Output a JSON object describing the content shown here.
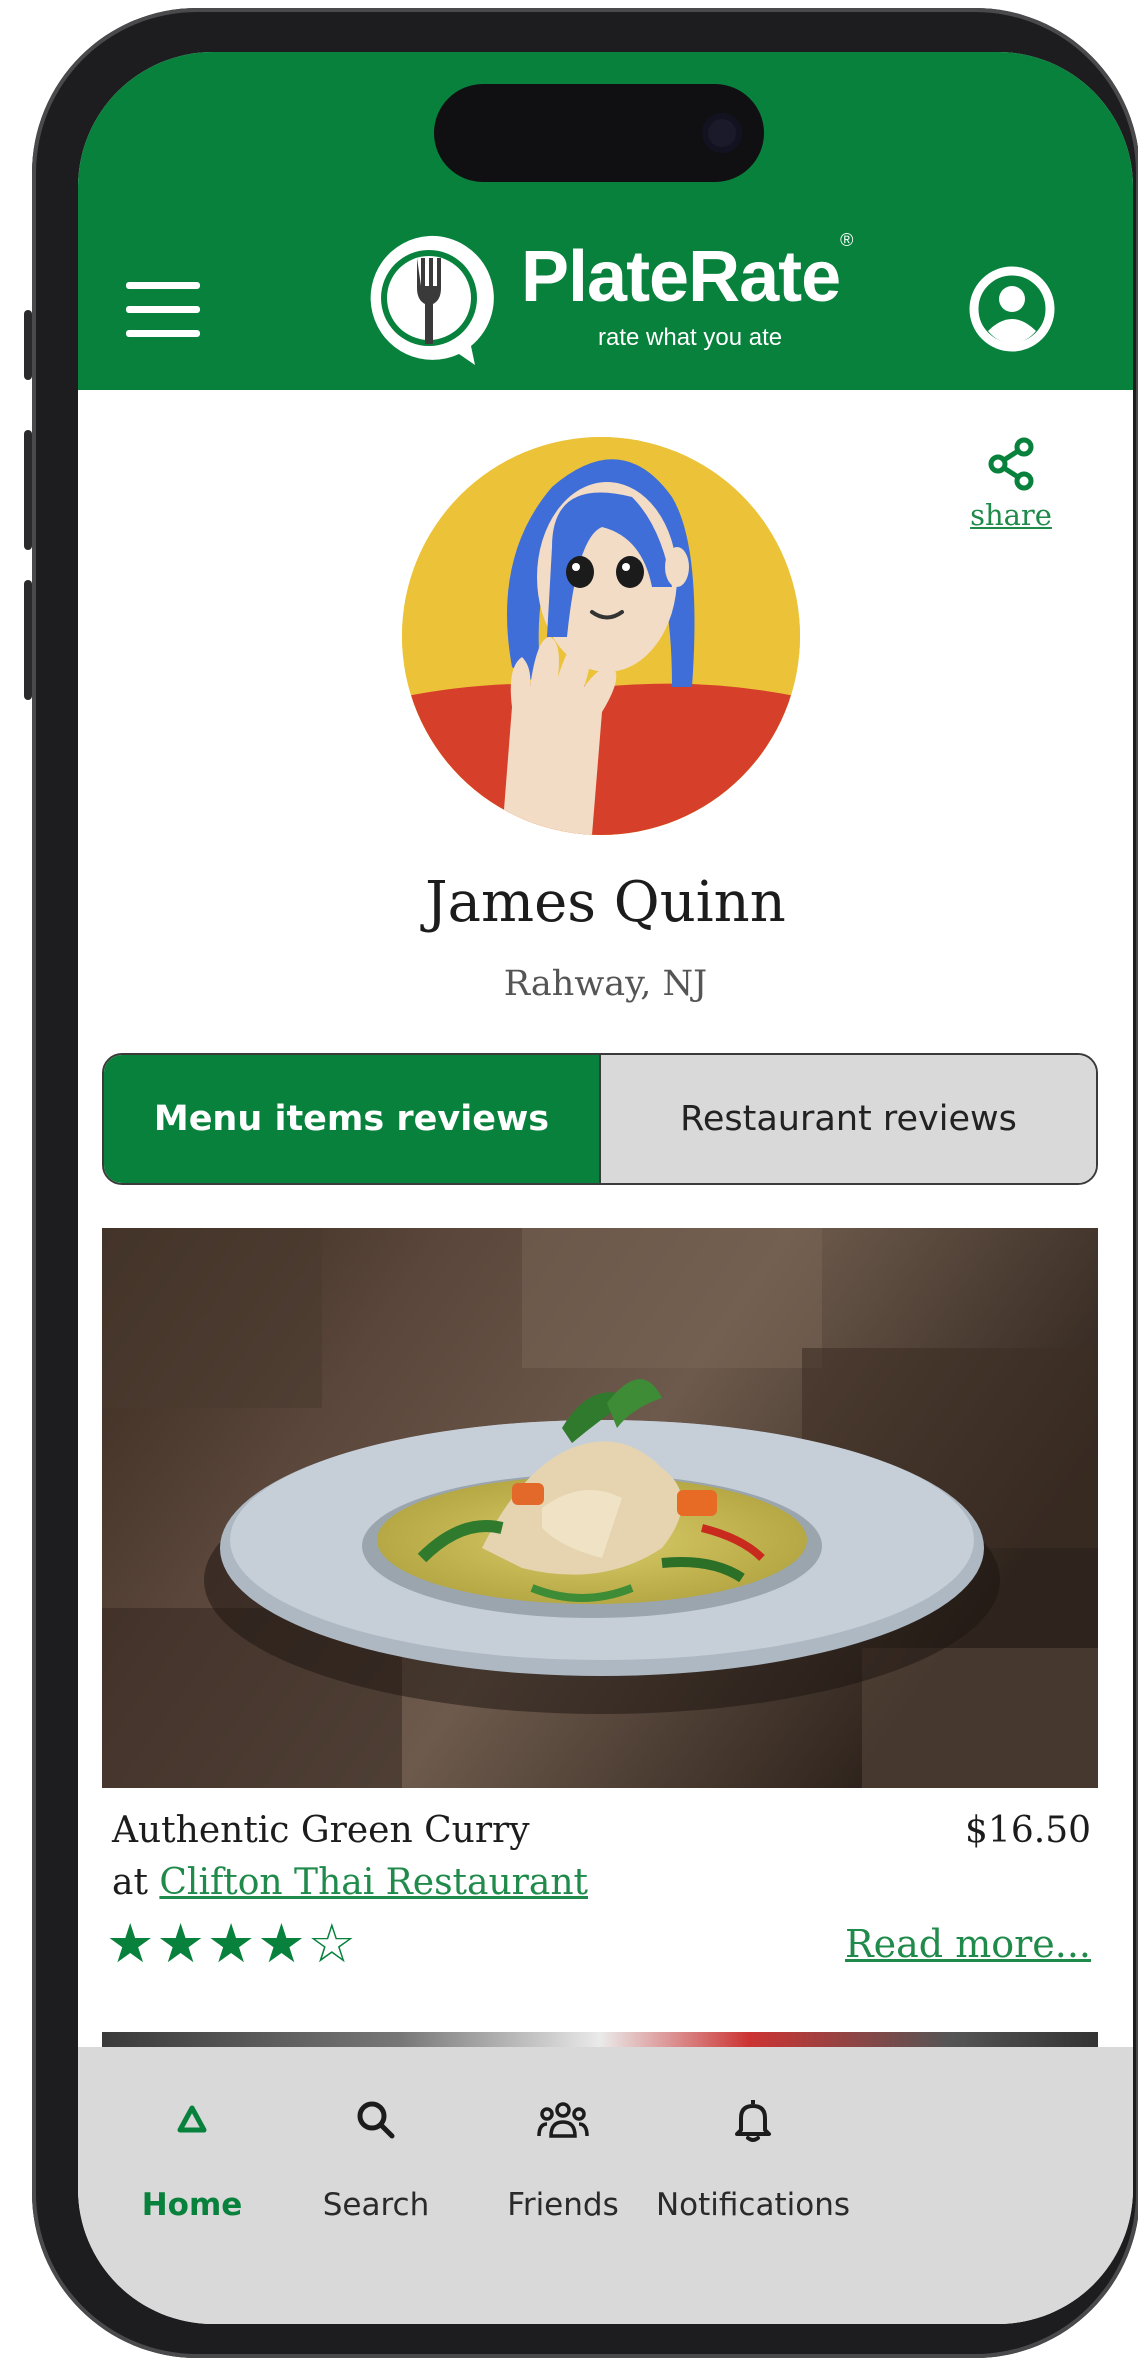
{
  "app": {
    "brand": "PlateRate",
    "brand_mark": "®",
    "tagline": "rate what you ate"
  },
  "profile": {
    "name": "James Quinn",
    "location": "Rahway, NJ",
    "share_label": "share"
  },
  "tabs": [
    {
      "label": "Menu items reviews",
      "active": true
    },
    {
      "label": "Restaurant reviews",
      "active": false
    }
  ],
  "review": {
    "dish": "Authentic Green Curry",
    "price": "$16.50",
    "at_prefix": "at",
    "restaurant": "Clifton Thai Restaurant",
    "rating": 4,
    "max_rating": 5,
    "stars_text": "★★★★☆",
    "read_more": "Read more..."
  },
  "nav": [
    {
      "label": "Home",
      "icon": "home-icon",
      "active": true
    },
    {
      "label": "Search",
      "icon": "search-icon",
      "active": false
    },
    {
      "label": "Friends",
      "icon": "friends-icon",
      "active": false
    },
    {
      "label": "Notifications",
      "icon": "bell-icon",
      "active": false
    }
  ],
  "colors": {
    "brand_green": "#07813c",
    "link_green": "#1f8a4a",
    "nav_bg": "#d9d9d9",
    "avatar_bg": "#ecc338"
  }
}
